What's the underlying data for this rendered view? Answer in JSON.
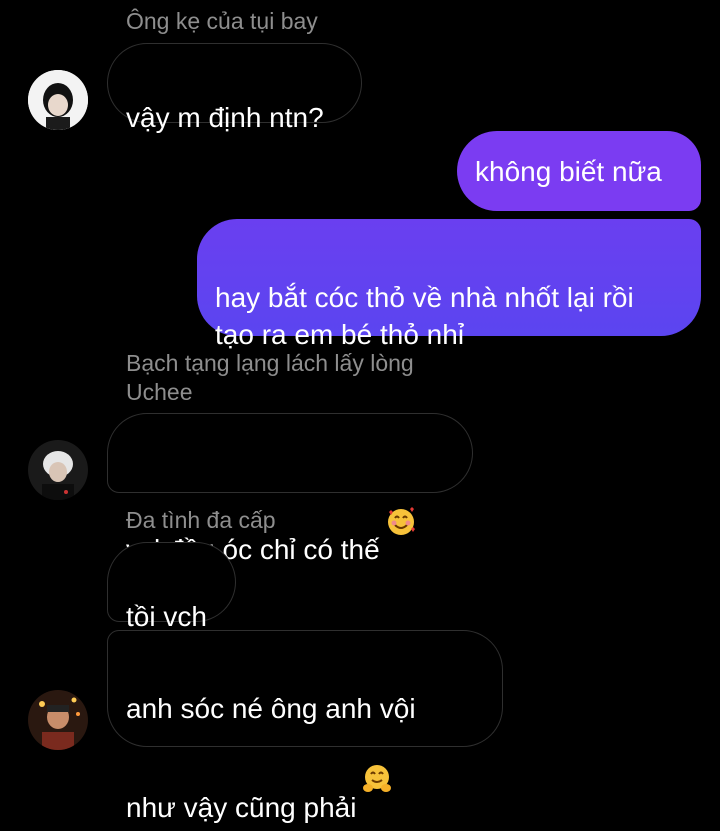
{
  "colors": {
    "background": "#000000",
    "incoming_border": "#2f2f2f",
    "sender_name": "#8e8e8e",
    "outgoing_top": "#7b3cf2",
    "outgoing_bottom": "#5b45f0"
  },
  "messages": [
    {
      "type": "sender",
      "text": "Ông kẹ của tụi bay"
    },
    {
      "type": "incoming",
      "text": "vậy m định ntn?"
    },
    {
      "type": "outgoing",
      "text": "không biết nữa"
    },
    {
      "type": "outgoing",
      "text": "hay bắt cóc thỏ về nhà nhốt lại rồi\ntạo ra em bé thỏ nhỉ"
    },
    {
      "type": "sender",
      "text": "Bạch tạng lạng lách lấy lòng\nUchee"
    },
    {
      "type": "incoming",
      "text": "vcl đầu óc chỉ có thế",
      "emoji": "smiling-face-with-hearts"
    },
    {
      "type": "sender",
      "text": "Đa tình đa cấp"
    },
    {
      "type": "incoming",
      "text": "tồi vch"
    },
    {
      "type": "incoming",
      "text": "anh sóc né ông anh vội\nnhư vậy cũng phải",
      "emoji": "hugging-face"
    }
  ]
}
